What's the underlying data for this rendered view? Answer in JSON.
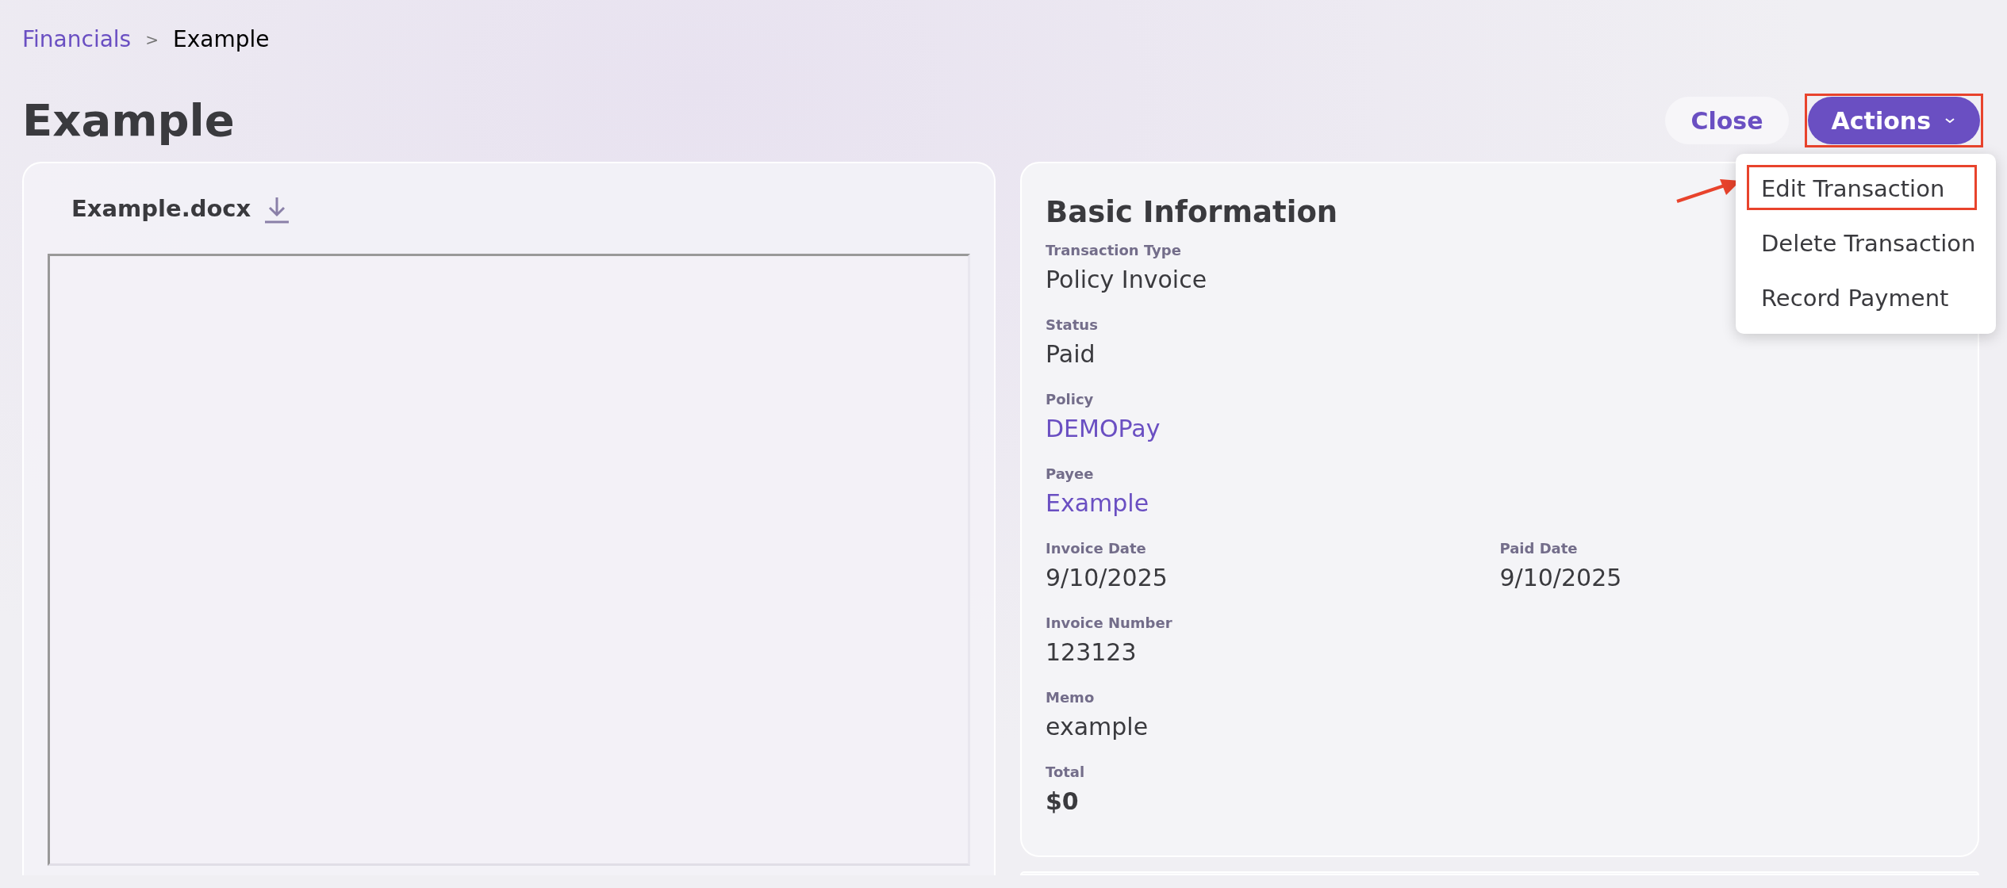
{
  "breadcrumb": [
    {
      "label": "Financials",
      "kind": "link"
    },
    {
      "label": "Example",
      "kind": "current"
    }
  ],
  "breadcrumb_separator": ">",
  "title": "Example",
  "header_buttons": [
    {
      "label": "Close",
      "kind": "secondary"
    },
    {
      "label": "Actions",
      "kind": "menu",
      "highlighted": true
    }
  ],
  "actions_menu": [
    {
      "label": "Edit Transaction",
      "highlighted": true
    },
    {
      "label": "Delete Transaction",
      "highlighted": false
    },
    {
      "label": "Record Payment",
      "highlighted": false
    }
  ],
  "document": {
    "file_name": "Example.docx"
  },
  "basic_information": {
    "heading": "Basic Information",
    "rows": [
      [
        {
          "label": "Transaction Type",
          "value": "Policy Invoice",
          "kind": "text"
        }
      ],
      [
        {
          "label": "Status",
          "value": "Paid",
          "kind": "text"
        }
      ],
      [
        {
          "label": "Policy",
          "value": "DEMOPay",
          "kind": "link"
        }
      ],
      [
        {
          "label": "Payee",
          "value": "Example",
          "kind": "link"
        }
      ],
      [
        {
          "label": "Invoice Date",
          "value": "9/10/2025",
          "kind": "text"
        },
        {
          "label": "Paid Date",
          "value": "9/10/2025",
          "kind": "text"
        }
      ],
      [
        {
          "label": "Invoice Number",
          "value": "123123",
          "kind": "text"
        }
      ],
      [
        {
          "label": "Memo",
          "value": "example",
          "kind": "text"
        }
      ],
      [
        {
          "label": "Total",
          "value": "$0",
          "kind": "bold"
        }
      ]
    ]
  }
}
